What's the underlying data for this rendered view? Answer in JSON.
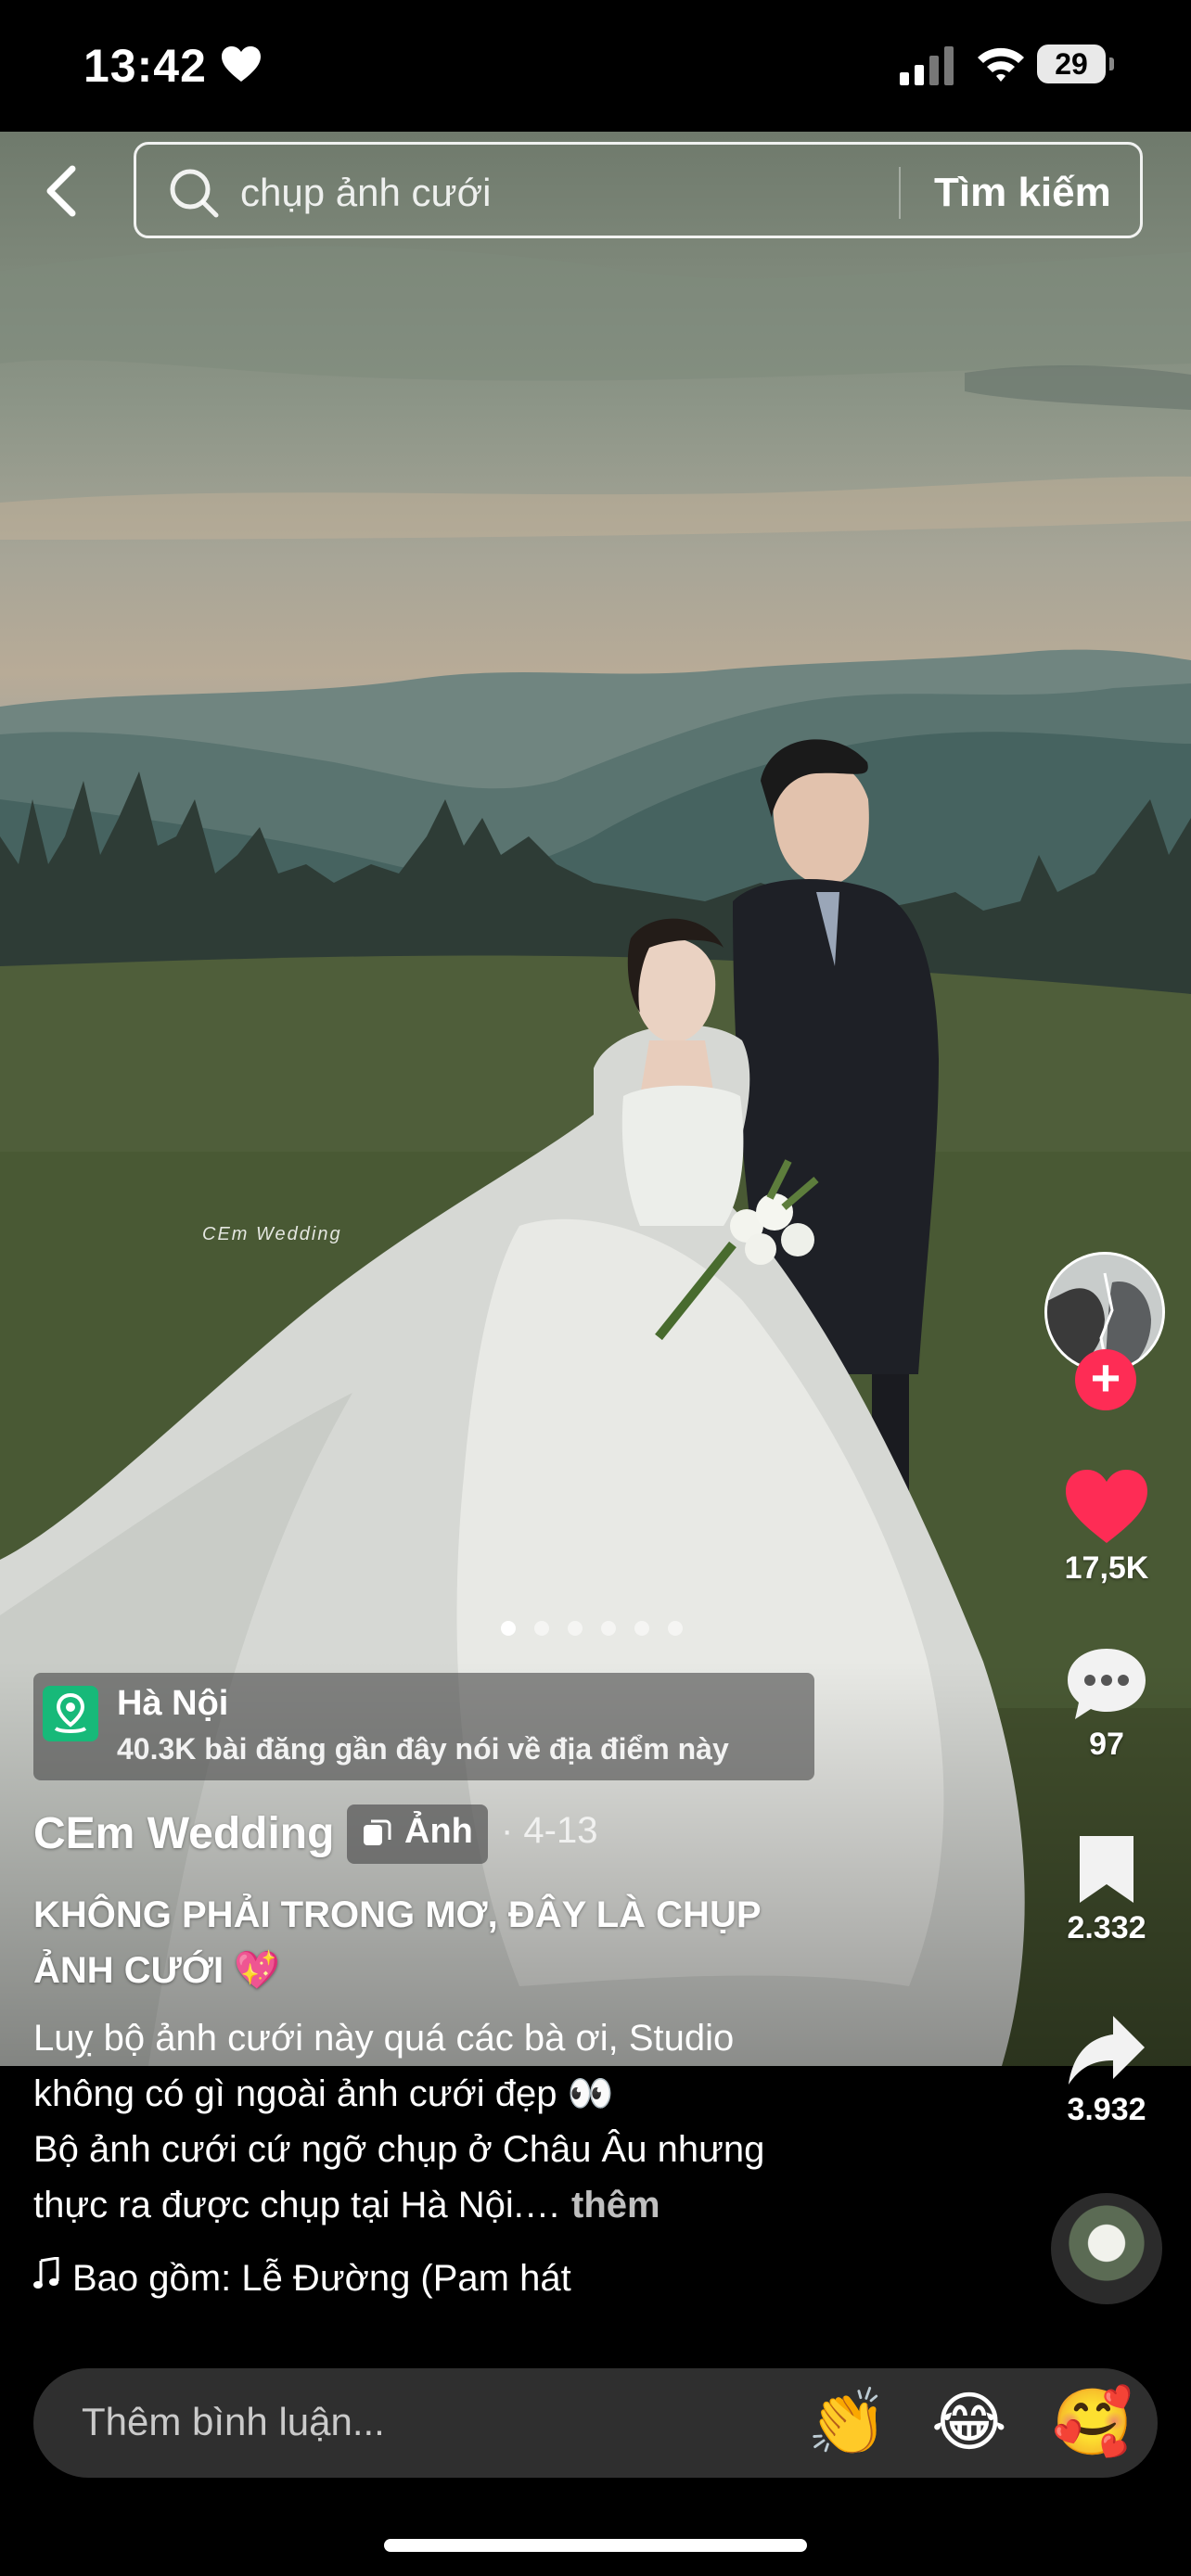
{
  "status_bar": {
    "time": "13:42",
    "battery": "29"
  },
  "search": {
    "query": "chụp ảnh cưới",
    "button_label": "Tìm kiếm"
  },
  "photo": {
    "watermark": "CEm Wedding",
    "slide_count": 6,
    "active_slide": 1
  },
  "actions": {
    "likes": "17,5K",
    "comments": "97",
    "saves": "2.332",
    "shares": "3.932"
  },
  "location": {
    "name": "Hà Nội",
    "subtitle": "40.3K bài đăng gần đây nói về địa điểm này"
  },
  "post": {
    "author": "CEm Wedding",
    "type_label": "Ảnh",
    "date": "· 4-13",
    "title_line1": "KHÔNG PHẢI TRONG MƠ, ĐÂY LÀ CHỤP",
    "title_line2": "ẢNH CƯỚI 💖",
    "desc_line1": "Luỵ bộ ảnh cưới này quá các bà ơi, Studio",
    "desc_line2": "không có gì ngoài ảnh cưới đẹp 👀",
    "desc_line3": "Bộ ảnh cưới cứ ngỡ chụp ở Châu Âu nhưng",
    "desc_line4": "thực ra được chụp tại Hà Nội.…",
    "more_label": "thêm",
    "music": "Bao gồm: Lễ Đường (Pam hát"
  },
  "comment_bar": {
    "placeholder": "Thêm bình luận...",
    "emojis": [
      "👏",
      "😂",
      "🥰"
    ]
  },
  "colors": {
    "accent_red": "#fe2c55",
    "location_green": "#17b979"
  }
}
